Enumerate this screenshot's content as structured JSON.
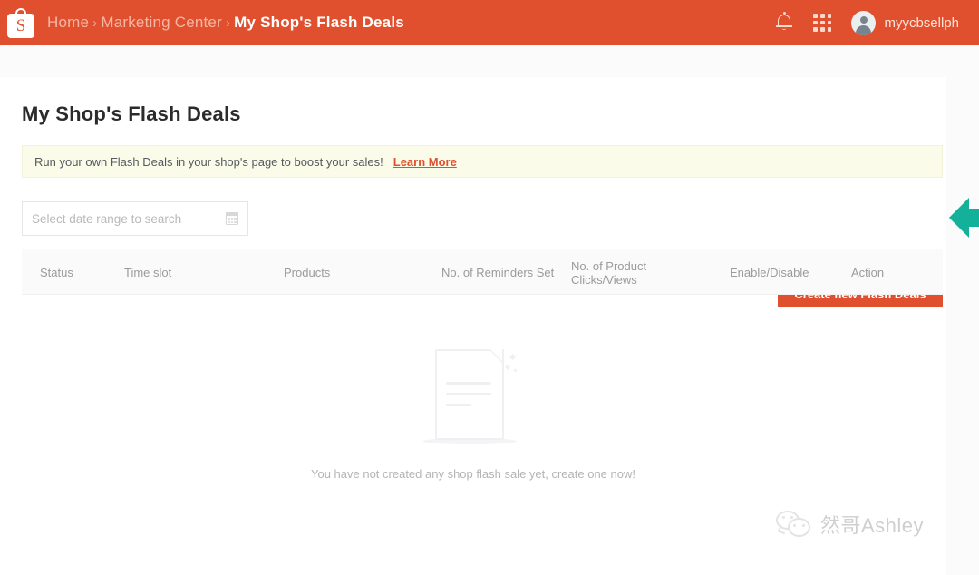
{
  "header": {
    "logo_icon": "shopee-bag-icon",
    "breadcrumb": [
      {
        "label": "Home",
        "current": false
      },
      {
        "label": "Marketing Center",
        "current": false
      },
      {
        "label": "My Shop's Flash Deals",
        "current": true
      }
    ],
    "separator": "›",
    "bell_icon": "notification-bell-icon",
    "grid_icon": "apps-grid-icon",
    "avatar_icon": "user-avatar-icon",
    "username": "myycbsellph",
    "background_color": "#e0502f"
  },
  "main": {
    "page_title": "My Shop's Flash Deals",
    "notice": {
      "text": "Run your own Flash Deals in your shop's page to boost your sales!",
      "link_label": "Learn More",
      "background_color": "#fbfbe9",
      "link_color": "#e0502f"
    },
    "date_range": {
      "placeholder": "Select date range to search",
      "value": "",
      "icon": "calendar-icon"
    },
    "create_button": {
      "label": "Create new Flash Deals",
      "color": "#e0502f"
    },
    "table": {
      "columns": [
        "Status",
        "Time slot",
        "Products",
        "No. of Reminders Set",
        "No. of Product Clicks/Views",
        "Enable/Disable",
        "Action"
      ],
      "rows": []
    },
    "empty_state": {
      "icon": "empty-document-icon",
      "message": "You have not created any shop flash sale yet, create one now!"
    }
  },
  "annotation": {
    "arrow_icon": "left-pointing-arrow-annotation",
    "color": "#13b09a"
  },
  "watermark": {
    "icon": "wechat-icon",
    "text": "然哥Ashley"
  }
}
